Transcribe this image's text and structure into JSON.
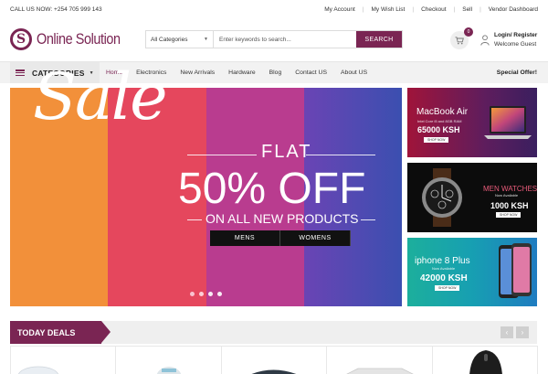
{
  "topbar": {
    "phone": "CALL US NOW: +254 705 999 143",
    "links": [
      "My Account",
      "My Wish List",
      "Checkout",
      "Sell",
      "Vendor Dashboard"
    ]
  },
  "header": {
    "logo_mark": "S",
    "logo_text": "Online Solution",
    "search_category": "All Categories",
    "search_placeholder": "Enter keywords to search...",
    "search_button": "SEARCH",
    "cart_count": "0",
    "login_label": "Login/ Register",
    "welcome": "Welcome Guest"
  },
  "nav": {
    "categories_label": "CATEGORIES",
    "items": [
      "Home",
      "Electronics",
      "New Arrivals",
      "Hardware",
      "Blog",
      "Contact US",
      "About US"
    ],
    "active": "Home",
    "special": "Special Offer!"
  },
  "hero": {
    "sale": "Sale",
    "flat": "FLAT",
    "discount": "50% OFF",
    "subline": "ON ALL NEW PRODUCTS",
    "buttons": [
      "MENS",
      "WOMENS"
    ],
    "slide_count": 4,
    "active_slide": 2,
    "colors": [
      "#f2903a",
      "#e5475d",
      "#b93c8f",
      "#6a44b4",
      "#3b4fb0"
    ]
  },
  "banners": [
    {
      "title": "MacBook Air",
      "sub": "Intel Core i5 and 8GB RAM",
      "price": "65000 KSH",
      "cta": "SHOP NOW"
    },
    {
      "title": "MEN WATCHES",
      "sub": "Now Available",
      "price": "1000 KSH",
      "cta": "SHOP NOW"
    },
    {
      "title": "iphone 8 Plus",
      "sub": "Now Available",
      "price": "42000 KSH",
      "cta": "SHOP NOW"
    }
  ],
  "deals": {
    "title": "TODAY DEALS",
    "prev": "‹",
    "next": "›"
  },
  "brand_color": "#7a2553"
}
